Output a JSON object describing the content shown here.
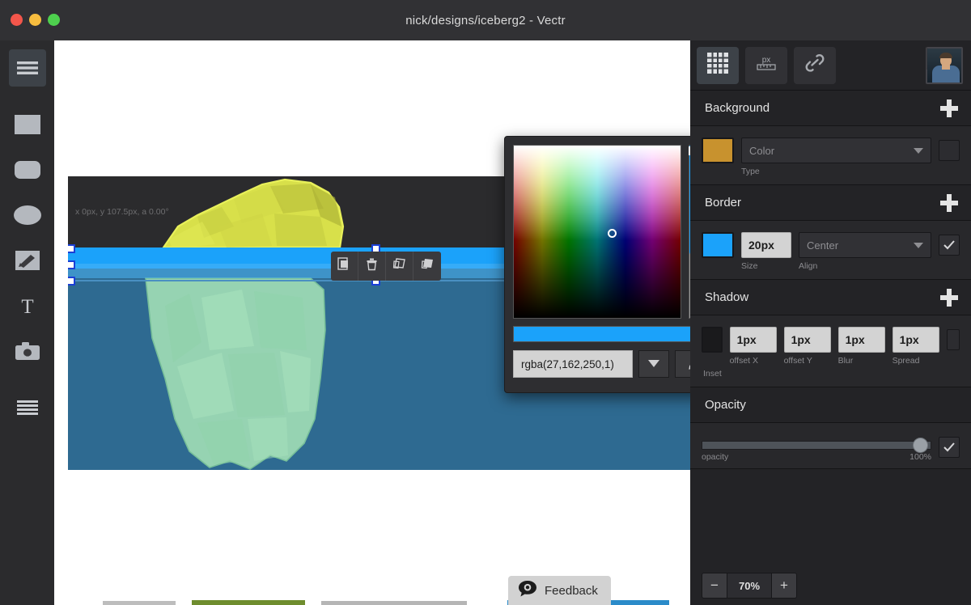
{
  "window": {
    "title": "nick/designs/iceberg2 - Vectr",
    "traffic_lights": [
      "close",
      "minimize",
      "maximize"
    ]
  },
  "left_toolbar": {
    "items": [
      {
        "name": "menu",
        "icon": "hamburger-icon",
        "active": true
      },
      {
        "name": "rectangle",
        "icon": "rectangle-icon",
        "active": false
      },
      {
        "name": "rounded-rectangle",
        "icon": "rounded-rectangle-icon",
        "active": false
      },
      {
        "name": "ellipse",
        "icon": "ellipse-icon",
        "active": false
      },
      {
        "name": "pen",
        "icon": "pen-icon",
        "active": false
      },
      {
        "name": "text",
        "icon": "text-icon",
        "active": false,
        "glyph": "T"
      },
      {
        "name": "image",
        "icon": "camera-icon",
        "active": false
      },
      {
        "name": "layers",
        "icon": "layers-icon",
        "active": false
      }
    ]
  },
  "canvas": {
    "coord_readout": "x 0px, y 107.5px, a 0.00°",
    "object_toolbar": [
      {
        "name": "duplicate",
        "icon": "duplicate-icon"
      },
      {
        "name": "delete",
        "icon": "trash-icon"
      },
      {
        "name": "bring-forward",
        "icon": "bring-forward-icon"
      },
      {
        "name": "send-backward",
        "icon": "send-backward-icon"
      }
    ],
    "artwork": {
      "name": "iceberg",
      "sea_color": "#2e6a91",
      "sky_color": "#2b2b2d",
      "water_band_color": "#1ba2fa",
      "tip_color": "#d8e04a",
      "submerged_color": "#9fdcb5"
    }
  },
  "color_picker": {
    "value": "rgba(27,162,250,1)",
    "hue_color": "#1ba2fa",
    "alpha_color": "#1ba2fa",
    "eyedropper_icon": "eyedropper-icon",
    "dropdown_icon": "chevron-down-icon"
  },
  "feedback": {
    "label": "Feedback",
    "icon": "feedback-bubble-icon"
  },
  "right_panel": {
    "toolbar": [
      {
        "name": "grid",
        "icon": "grid-icon",
        "label": "",
        "active": true
      },
      {
        "name": "units",
        "icon": "ruler-icon",
        "label": "px",
        "active": false
      },
      {
        "name": "link",
        "icon": "link-icon",
        "label": "",
        "active": false
      }
    ],
    "avatar": {
      "name": "user-avatar"
    },
    "sections": [
      {
        "title": "Background",
        "add_label": "+",
        "color": "#c8922e",
        "type_value": "Color",
        "type_sublabel": "Type",
        "enabled": false
      },
      {
        "title": "Border",
        "add_label": "+",
        "color": "#1ba2fa",
        "size_value": "20px",
        "size_sublabel": "Size",
        "align_value": "Center",
        "align_sublabel": "Align",
        "enabled": true
      },
      {
        "title": "Shadow",
        "add_label": "+",
        "color": "#1a1a1c",
        "fields": [
          {
            "value": "1px",
            "label": "offset X"
          },
          {
            "value": "1px",
            "label": "offset Y"
          },
          {
            "value": "1px",
            "label": "Blur"
          },
          {
            "value": "1px",
            "label": "Spread"
          }
        ],
        "inset_label": "Inset",
        "enabled": false
      },
      {
        "title": "Opacity",
        "slider_label": "opacity",
        "slider_value": "100%",
        "enabled": true
      }
    ],
    "zoom": {
      "minus": "−",
      "value": "70%",
      "plus": "+"
    }
  }
}
